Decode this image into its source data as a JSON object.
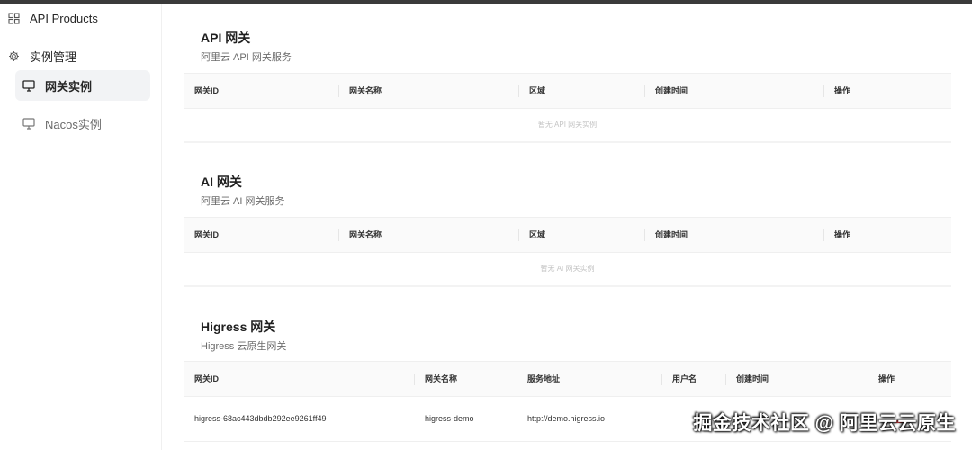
{
  "sidebar": {
    "api_products": "API Products",
    "instance_mgmt": "实例管理",
    "gateway_instance": "网关实例",
    "nacos_instance": "Nacos实例"
  },
  "sections": [
    {
      "title": "API 网关",
      "subtitle": "阿里云 API 网关服务",
      "columns": [
        "网关ID",
        "网关名称",
        "区域",
        "创建时间",
        "操作"
      ],
      "empty_text": "暂无 API 网关实例"
    },
    {
      "title": "AI 网关",
      "subtitle": "阿里云 AI 网关服务",
      "columns": [
        "网关ID",
        "网关名称",
        "区域",
        "创建时间",
        "操作"
      ],
      "empty_text": "暂无 AI 网关实例"
    },
    {
      "title": "Higress 网关",
      "subtitle": "Higress 云原生网关",
      "columns": [
        "网关ID",
        "网关名称",
        "服务地址",
        "用户名",
        "创建时间",
        "操作"
      ],
      "rows": [
        {
          "gateway_id": "higress-68ac443dbdb292ee9261ff49",
          "gateway_name": "higress-demo",
          "service_address": "http://demo.higress.io"
        }
      ]
    }
  ],
  "watermark": "掘金技术社区 @ 阿里云云原生",
  "icons": {
    "api_products": "grid-icon",
    "instance_mgmt": "gear-icon",
    "gateway_instance": "monitor-icon",
    "nacos_instance": "monitor-icon"
  }
}
